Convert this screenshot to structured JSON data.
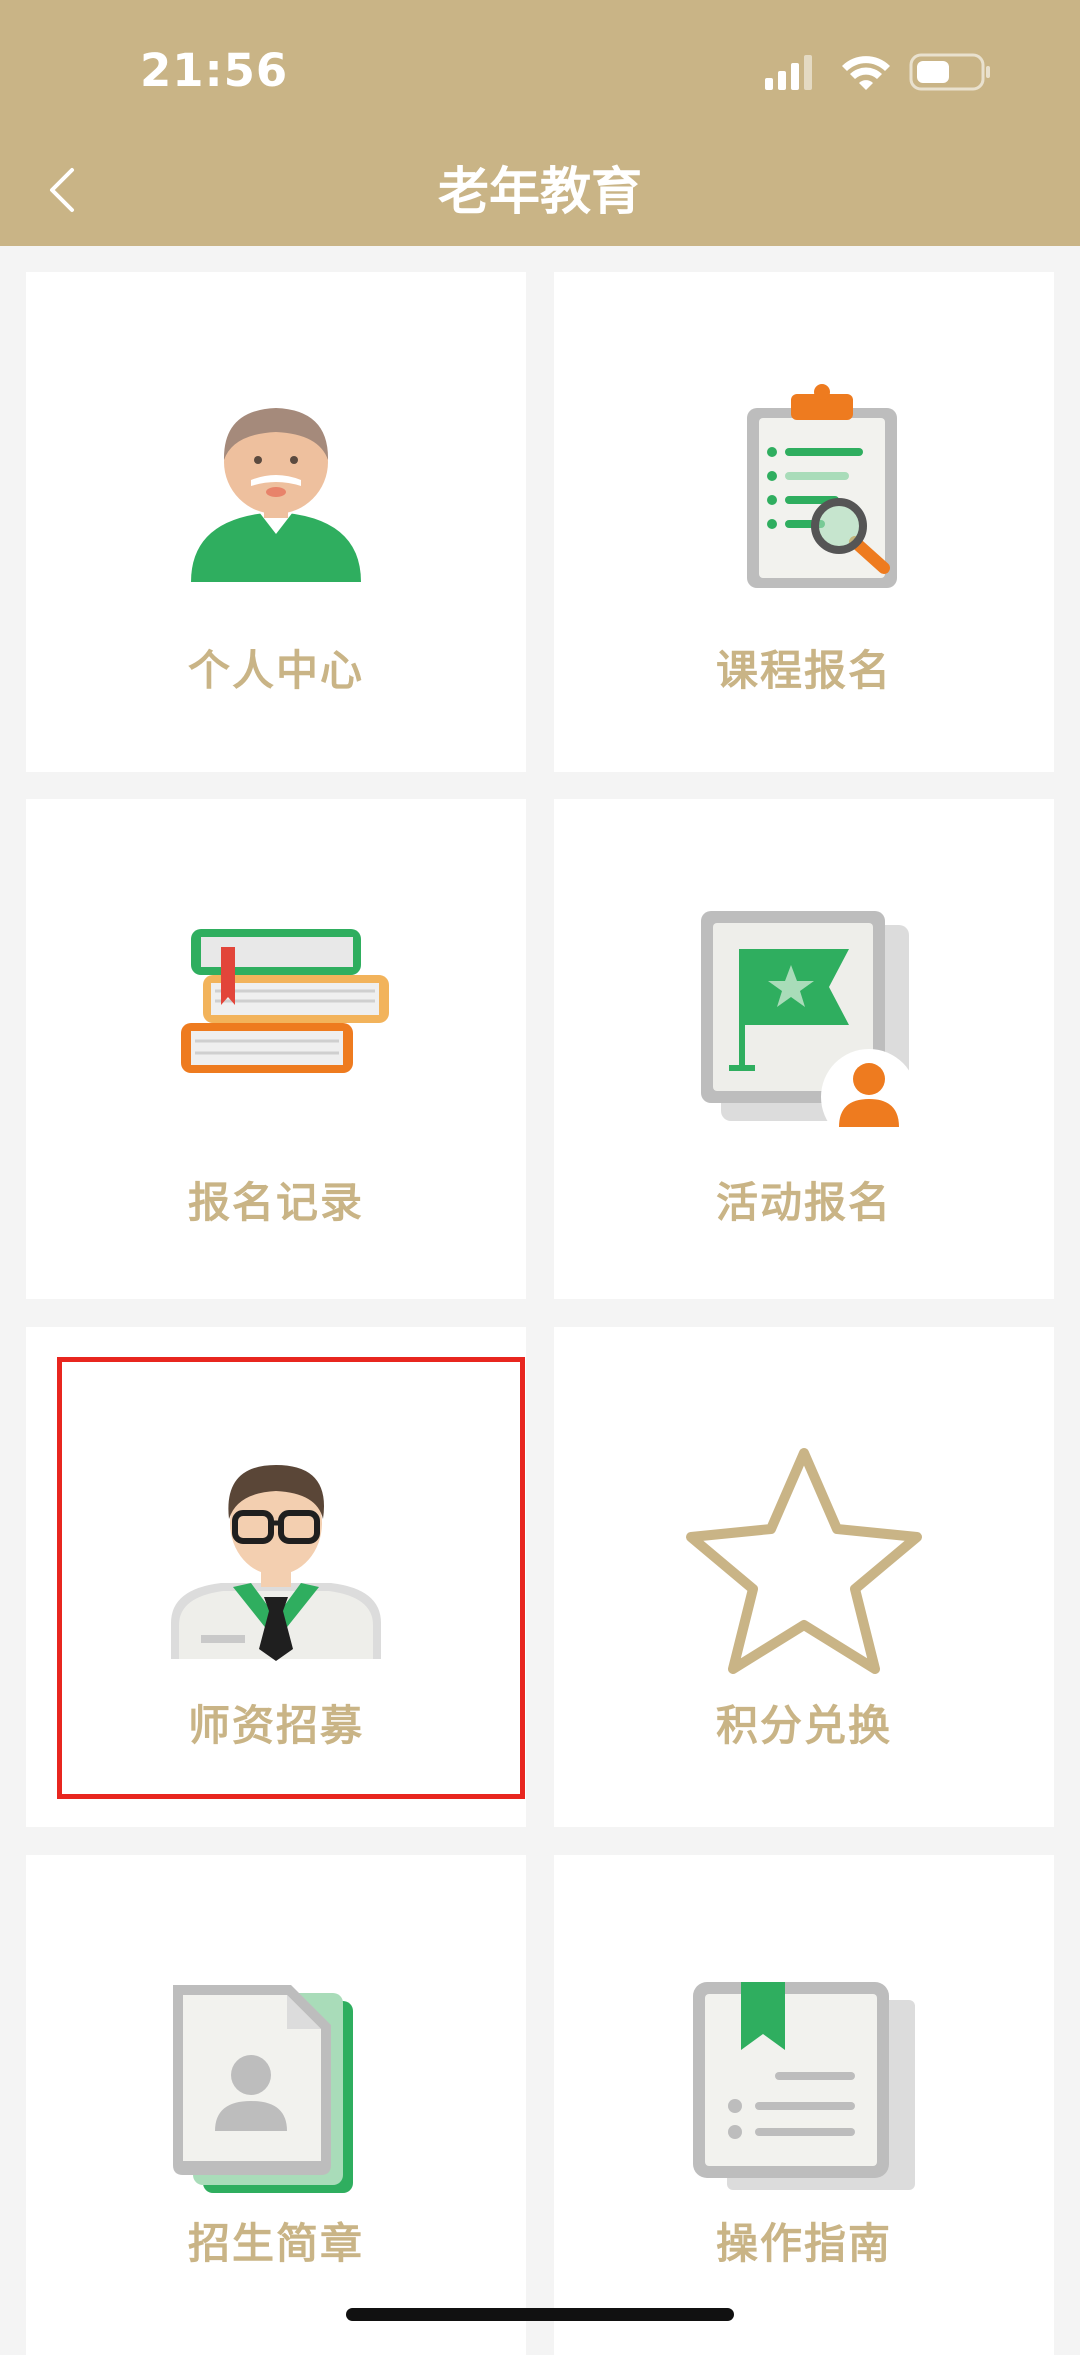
{
  "status_bar": {
    "time": "21:56"
  },
  "nav": {
    "title": "老年教育",
    "back_icon": "chevron-left-icon"
  },
  "tiles": [
    {
      "label": "个人中心",
      "icon": "elderly-person-icon"
    },
    {
      "label": "课程报名",
      "icon": "clipboard-search-icon"
    },
    {
      "label": "报名记录",
      "icon": "books-stack-icon"
    },
    {
      "label": "活动报名",
      "icon": "flag-person-icon"
    },
    {
      "label": "师资招募",
      "icon": "teacher-icon"
    },
    {
      "label": "积分兑换",
      "icon": "star-icon"
    },
    {
      "label": "招生简章",
      "icon": "profile-document-icon"
    },
    {
      "label": "操作指南",
      "icon": "guide-book-icon"
    }
  ],
  "colors": {
    "brand": "#c9b486",
    "highlight": "#e8261f",
    "green": "#2fae5f",
    "orange": "#ee7b1f"
  }
}
